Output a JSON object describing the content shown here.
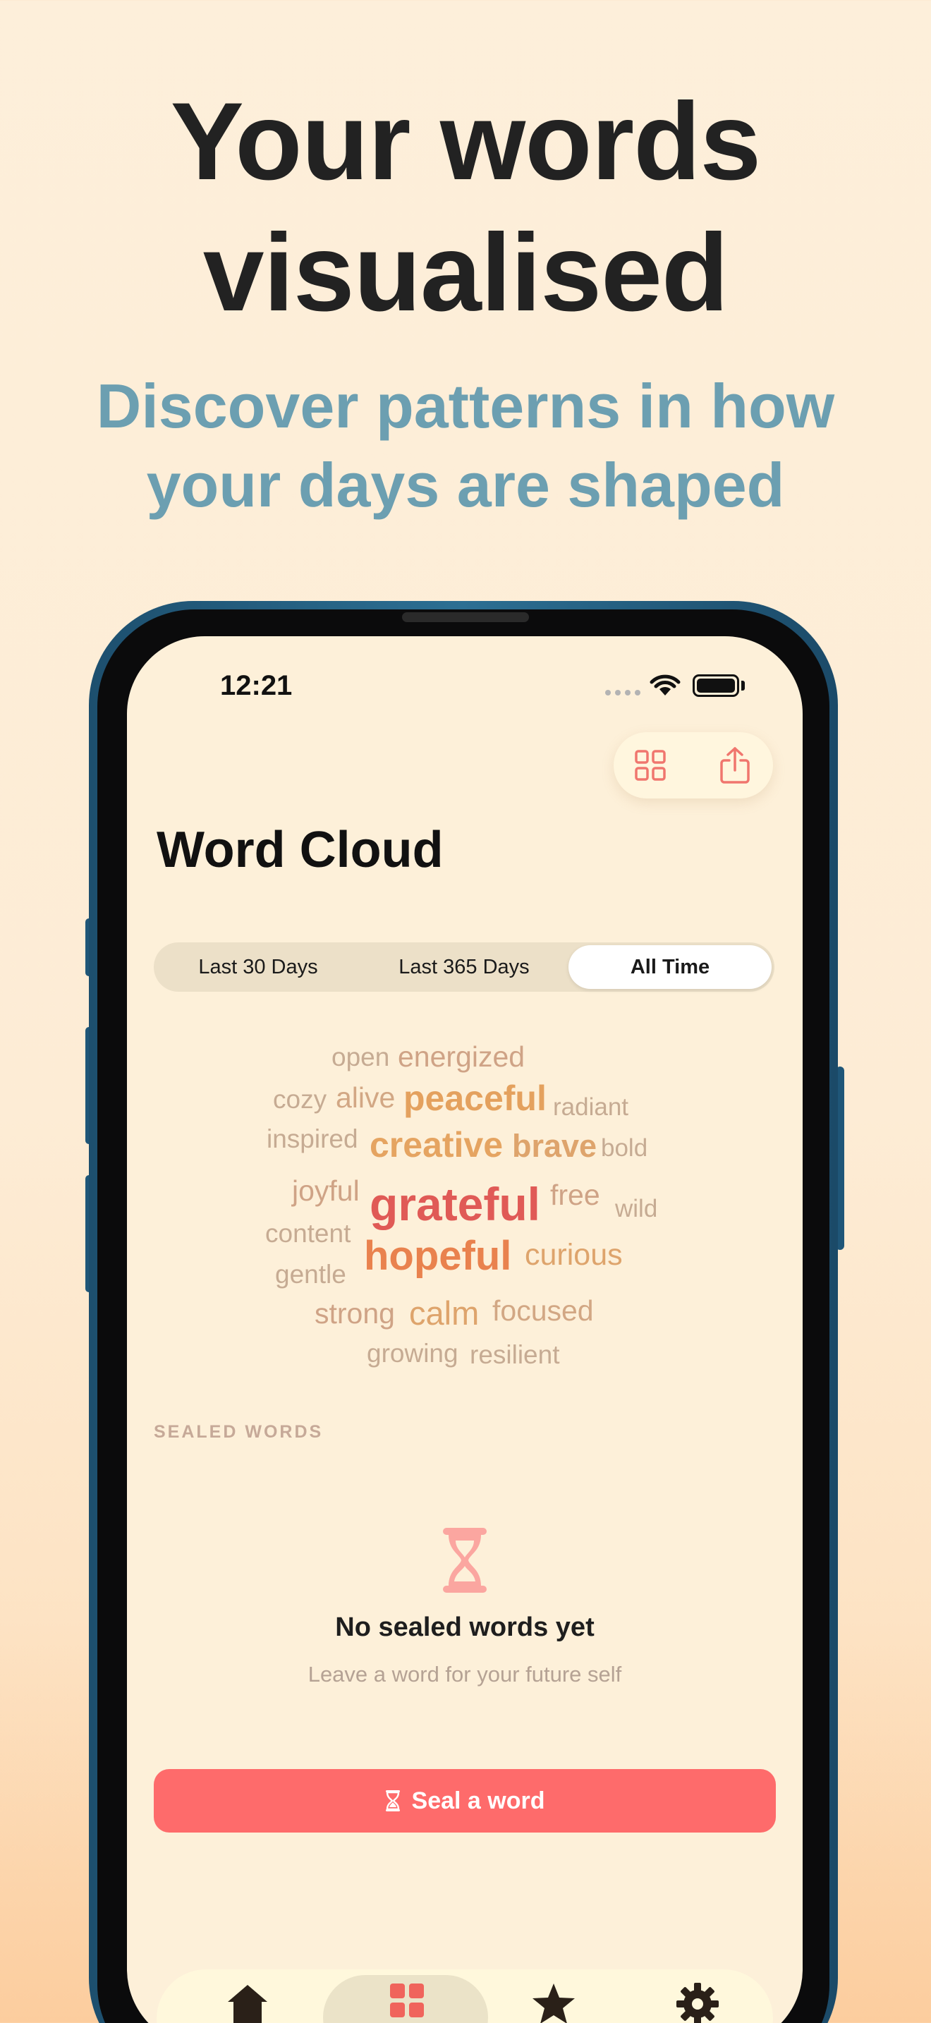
{
  "promo": {
    "headline_line1": "Your words",
    "headline_line2": "visualised",
    "subheadline_line1": "Discover patterns in how",
    "subheadline_line2": "your days are shaped"
  },
  "status_bar": {
    "time": "12:21"
  },
  "toolbar": {
    "grid_icon": "grid-icon",
    "share_icon": "share-icon"
  },
  "page": {
    "title": "Word Cloud"
  },
  "range_selector": {
    "options": [
      "Last 30 Days",
      "Last 365 Days",
      "All Time"
    ],
    "selected": "All Time"
  },
  "word_cloud": [
    {
      "word": "open",
      "color": "#c6ab93"
    },
    {
      "word": "energized",
      "color": "#cfa386"
    },
    {
      "word": "cozy",
      "color": "#c6ab93"
    },
    {
      "word": "alive",
      "color": "#d2a784"
    },
    {
      "word": "peaceful",
      "color": "#e4a15e"
    },
    {
      "word": "radiant",
      "color": "#c6ab93"
    },
    {
      "word": "inspired",
      "color": "#c6ab93"
    },
    {
      "word": "creative",
      "color": "#e5a461"
    },
    {
      "word": "brave",
      "color": "#dea46c"
    },
    {
      "word": "bold",
      "color": "#c6ab93"
    },
    {
      "word": "joyful",
      "color": "#cfa386"
    },
    {
      "word": "grateful",
      "color": "#e05a56"
    },
    {
      "word": "free",
      "color": "#cfa386"
    },
    {
      "word": "wild",
      "color": "#c6ab93"
    },
    {
      "word": "content",
      "color": "#c6ab93"
    },
    {
      "word": "hopeful",
      "color": "#e9824e"
    },
    {
      "word": "curious",
      "color": "#dea46c"
    },
    {
      "word": "gentle",
      "color": "#c6ab93"
    },
    {
      "word": "strong",
      "color": "#cfa386"
    },
    {
      "word": "calm",
      "color": "#dea46c"
    },
    {
      "word": "focused",
      "color": "#d2a784"
    },
    {
      "word": "growing",
      "color": "#c6ab93"
    },
    {
      "word": "resilient",
      "color": "#c6ab93"
    }
  ],
  "sealed": {
    "section_label": "SEALED WORDS",
    "empty_title": "No sealed words yet",
    "empty_subtitle": "Leave a word for your future self",
    "button_label": "Seal a word"
  },
  "tab_bar": {
    "items": [
      "home-icon",
      "grid-icon",
      "star-icon",
      "gear-icon"
    ],
    "active": "grid-icon"
  },
  "colors": {
    "accent": "#fe6b6b",
    "background": "#fdf0d9",
    "phone_frame": "#2c6f93",
    "subheadline": "#6c9fb1"
  }
}
